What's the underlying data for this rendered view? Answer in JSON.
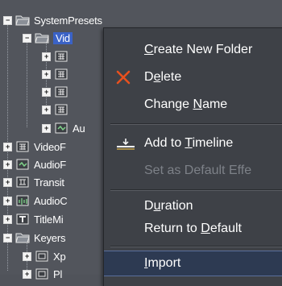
{
  "tree": {
    "items": [
      {
        "label": "SystemPresets",
        "expander": "−",
        "icon": "folder-open-icon"
      },
      {
        "label": "Vid",
        "expander": "−",
        "icon": "folder-open-icon"
      },
      {
        "label": "",
        "expander": "+",
        "icon": "grid-preset-icon"
      },
      {
        "label": "",
        "expander": "+",
        "icon": "grid-preset-icon"
      },
      {
        "label": "",
        "expander": "+",
        "icon": "grid-preset-icon"
      },
      {
        "label": "",
        "expander": "+",
        "icon": "grid-preset-icon"
      },
      {
        "label": "Au",
        "expander": "+",
        "icon": "audio-preset-icon"
      },
      {
        "label": "VideoF",
        "expander": "+",
        "icon": "grid-preset-icon"
      },
      {
        "label": "AudioF",
        "expander": "+",
        "icon": "audio-preset-icon"
      },
      {
        "label": "Transit",
        "expander": "+",
        "icon": "transition-preset-icon"
      },
      {
        "label": "AudioC",
        "expander": "+",
        "icon": "audio-c-preset-icon"
      },
      {
        "label": "TitleMi",
        "expander": "+",
        "icon": "title-preset-icon"
      },
      {
        "label": "Keyers",
        "expander": "−",
        "icon": "folder-open-icon"
      },
      {
        "label": "Xp",
        "expander": "+",
        "icon": "keyer-preset-icon"
      },
      {
        "label": "Pl",
        "expander": "+",
        "icon": "keyer-preset-icon"
      }
    ]
  },
  "context_menu": {
    "items": [
      {
        "before": "",
        "u": "C",
        "after": "reate New Folder",
        "icon": "",
        "disabled": false
      },
      {
        "before": "D",
        "u": "e",
        "after": "lete",
        "icon": "delete-x-icon",
        "disabled": false
      },
      {
        "before": "Change ",
        "u": "N",
        "after": "ame",
        "icon": "",
        "disabled": false
      },
      {
        "before": "Add to ",
        "u": "T",
        "after": "imeline",
        "icon": "add-to-timeline-icon",
        "disabled": false
      },
      {
        "before": "Set as Default Effe",
        "u": "",
        "after": "",
        "icon": "",
        "disabled": true
      },
      {
        "before": "D",
        "u": "u",
        "after": "ration",
        "icon": "",
        "disabled": false
      },
      {
        "before": "Return to ",
        "u": "D",
        "after": "efault",
        "icon": "",
        "disabled": false
      },
      {
        "before": "",
        "u": "I",
        "after": "mport",
        "icon": "",
        "disabled": false
      }
    ]
  },
  "colors": {
    "background": "#52555c",
    "menu_background": "#3e4147",
    "selection": "#3a62c6",
    "highlight": "#2d3a52",
    "delete_red": "#e8501e"
  }
}
